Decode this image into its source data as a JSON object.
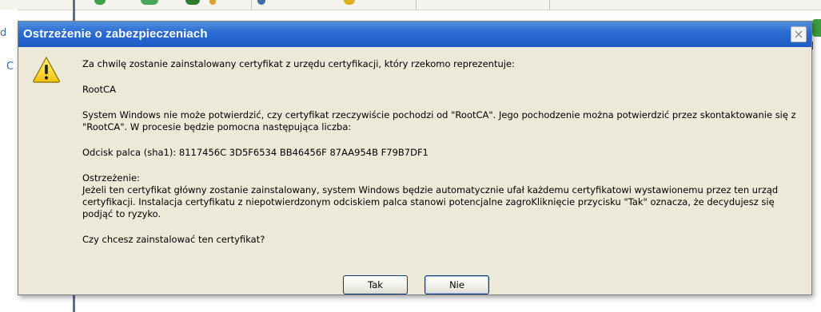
{
  "background": {
    "left_letters": [
      "d",
      "C"
    ]
  },
  "dialog": {
    "title": "Ostrzeżenie o zabezpieczeniach",
    "close_symbol": "×",
    "paragraphs": [
      "Za chwilę zostanie zainstalowany certyfikat z urzędu certyfikacji, który rzekomo reprezentuje:",
      "RootCA",
      "System Windows nie może potwierdzić, czy certyfikat rzeczywiście pochodzi od \"RootCA\". Jego pochodzenie można potwierdzić przez skontaktowanie się z \"RootCA\". W procesie będzie pomocna następująca liczba:",
      "Odcisk palca (sha1): 8117456C 3D5F6534 BB46456F 87AA954B F79B7DF1",
      "Ostrzeżenie:",
      "Jeżeli ten certyfikat główny zostanie zainstalowany, system Windows będzie automatycznie ufał każdemu certyfikatowi wystawionemu przez ten urząd certyfikacji. Instalacja certyfikatu z niepotwierdzonym odciskiem palca stanowi potencjalne zagroKliknięcie przycisku \"Tak\" oznacza, że decydujesz się podjąć to ryzyko.",
      "Czy chcesz zainstalować ten certyfikat?"
    ],
    "buttons": {
      "yes": "Tak",
      "no": "Nie"
    }
  },
  "colors": {
    "titlebar": "#2a6ad0",
    "dialog_bg": "#ece9d8",
    "warning_yellow": "#f6d91a"
  },
  "icons": {
    "warning": "warning-triangle-icon",
    "close": "close-icon"
  }
}
